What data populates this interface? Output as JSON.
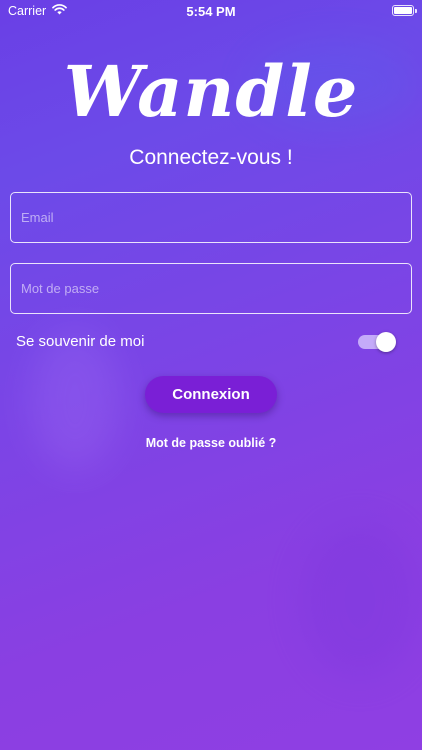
{
  "status_bar": {
    "carrier": "Carrier",
    "time": "5:54 PM",
    "wifi_icon": "wifi-icon",
    "battery_icon": "battery-icon"
  },
  "brand": {
    "logo_text": "Wandle"
  },
  "login": {
    "title": "Connectez-vous !",
    "email_placeholder": "Email",
    "email_value": "",
    "password_placeholder": "Mot de passe",
    "password_value": "",
    "remember_label": "Se souvenir de moi",
    "remember_on": true,
    "submit_label": "Connexion",
    "forgot_label": "Mot de passe oublié ?"
  },
  "colors": {
    "background_start": "#6a3fe6",
    "background_end": "#8f3fe3",
    "button": "#7a1fd6",
    "text": "#ffffff"
  }
}
